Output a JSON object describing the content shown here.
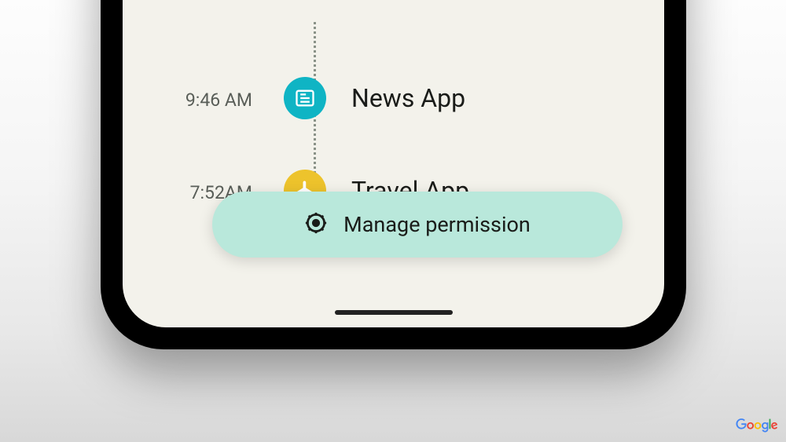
{
  "timeline": {
    "items": [
      {
        "time": "9:46 AM",
        "name": "News App"
      },
      {
        "time": "7:52AM",
        "name": "Travel App"
      }
    ]
  },
  "action": {
    "label": "Manage permission"
  }
}
